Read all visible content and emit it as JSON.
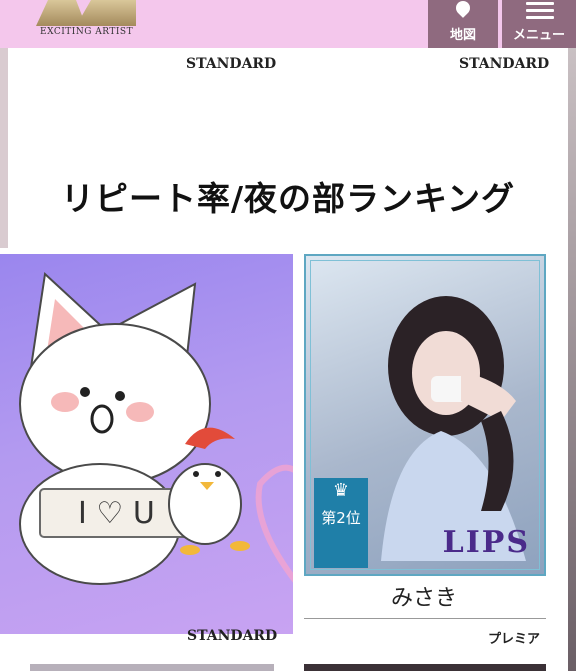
{
  "header": {
    "logo_sub": "EXCITING  ARTIST",
    "map_label": "地図",
    "menu_label": "メニュー"
  },
  "tags": {
    "top_left": "STANDARD",
    "top_right": "STANDARD",
    "bottom_left": "STANDARD",
    "bottom_right": "プレミア"
  },
  "section": {
    "heading": "リピート率/夜の部ランキング"
  },
  "card": {
    "rank_label": "第2位",
    "logo_text": "LIPS",
    "name": "みさき"
  },
  "sticker": {
    "text": "I ♡ U",
    "bg_color": "#9a86ee"
  },
  "colors": {
    "header_bg": "#f4c7ec",
    "nav_bg": "#8f6a7f",
    "rank_badge": "#1f7fa8"
  }
}
